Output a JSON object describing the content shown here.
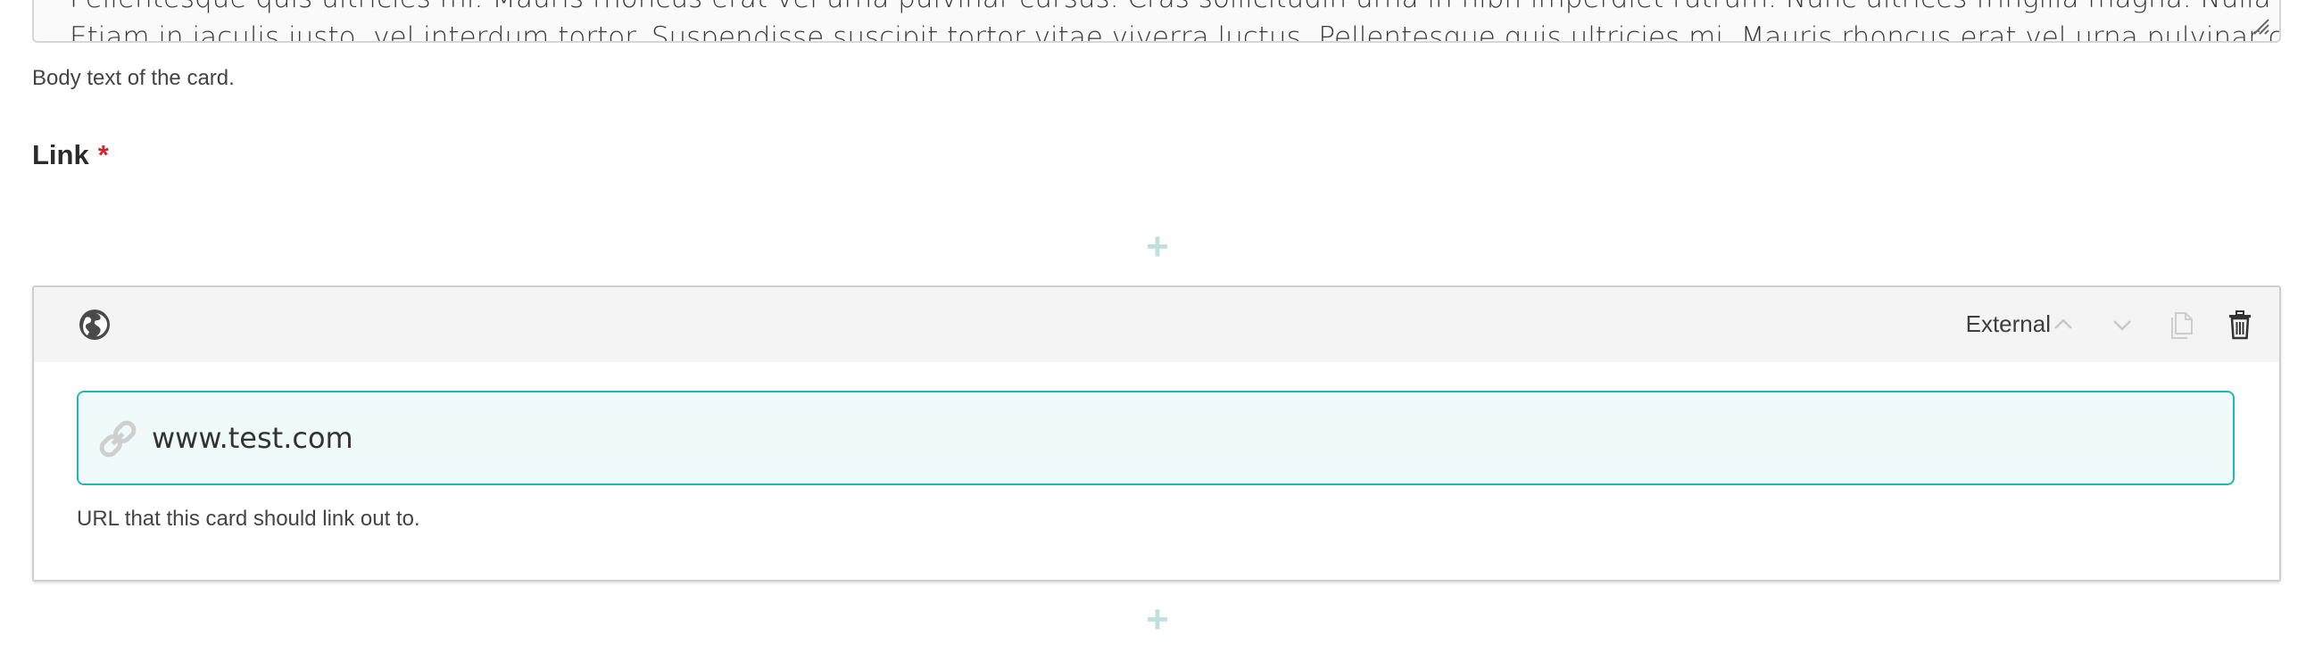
{
  "body_field": {
    "text_line1": "Pellentesque quis ultricies mi. Mauris rhoncus erat vel urna pulvinar cursus. Cras sollicitudin urna in nibh imperdiet rutrum. Nunc ultrices fringilla magna. Nulla facilisi.",
    "text_line2": "Etiam in iaculis justo, vel interdum tortor. Suspendisse suscipit tortor vitae viverra luctus. Pellentesque quis ultricies mi. Mauris rhoncus erat vel urna pulvinar cursus.",
    "help": "Body text of the card."
  },
  "link_field": {
    "label": "Link",
    "required_mark": "*"
  },
  "add_button": {
    "symbol": "+"
  },
  "link_card": {
    "type_label": "External",
    "icons": {
      "globe": "globe-icon",
      "move_up": "chevron-up-icon",
      "move_down": "chevron-down-icon",
      "duplicate": "copy-icon",
      "delete": "trash-icon",
      "link": "link-icon"
    },
    "url_value": "www.test.com",
    "help": "URL that this card should link out to."
  },
  "colors": {
    "accent": "#1fb8b8",
    "input_background": "#f1fafa",
    "required": "#d0262d",
    "add_button": "#bfe0dd",
    "header_background": "#f4f4f4"
  }
}
